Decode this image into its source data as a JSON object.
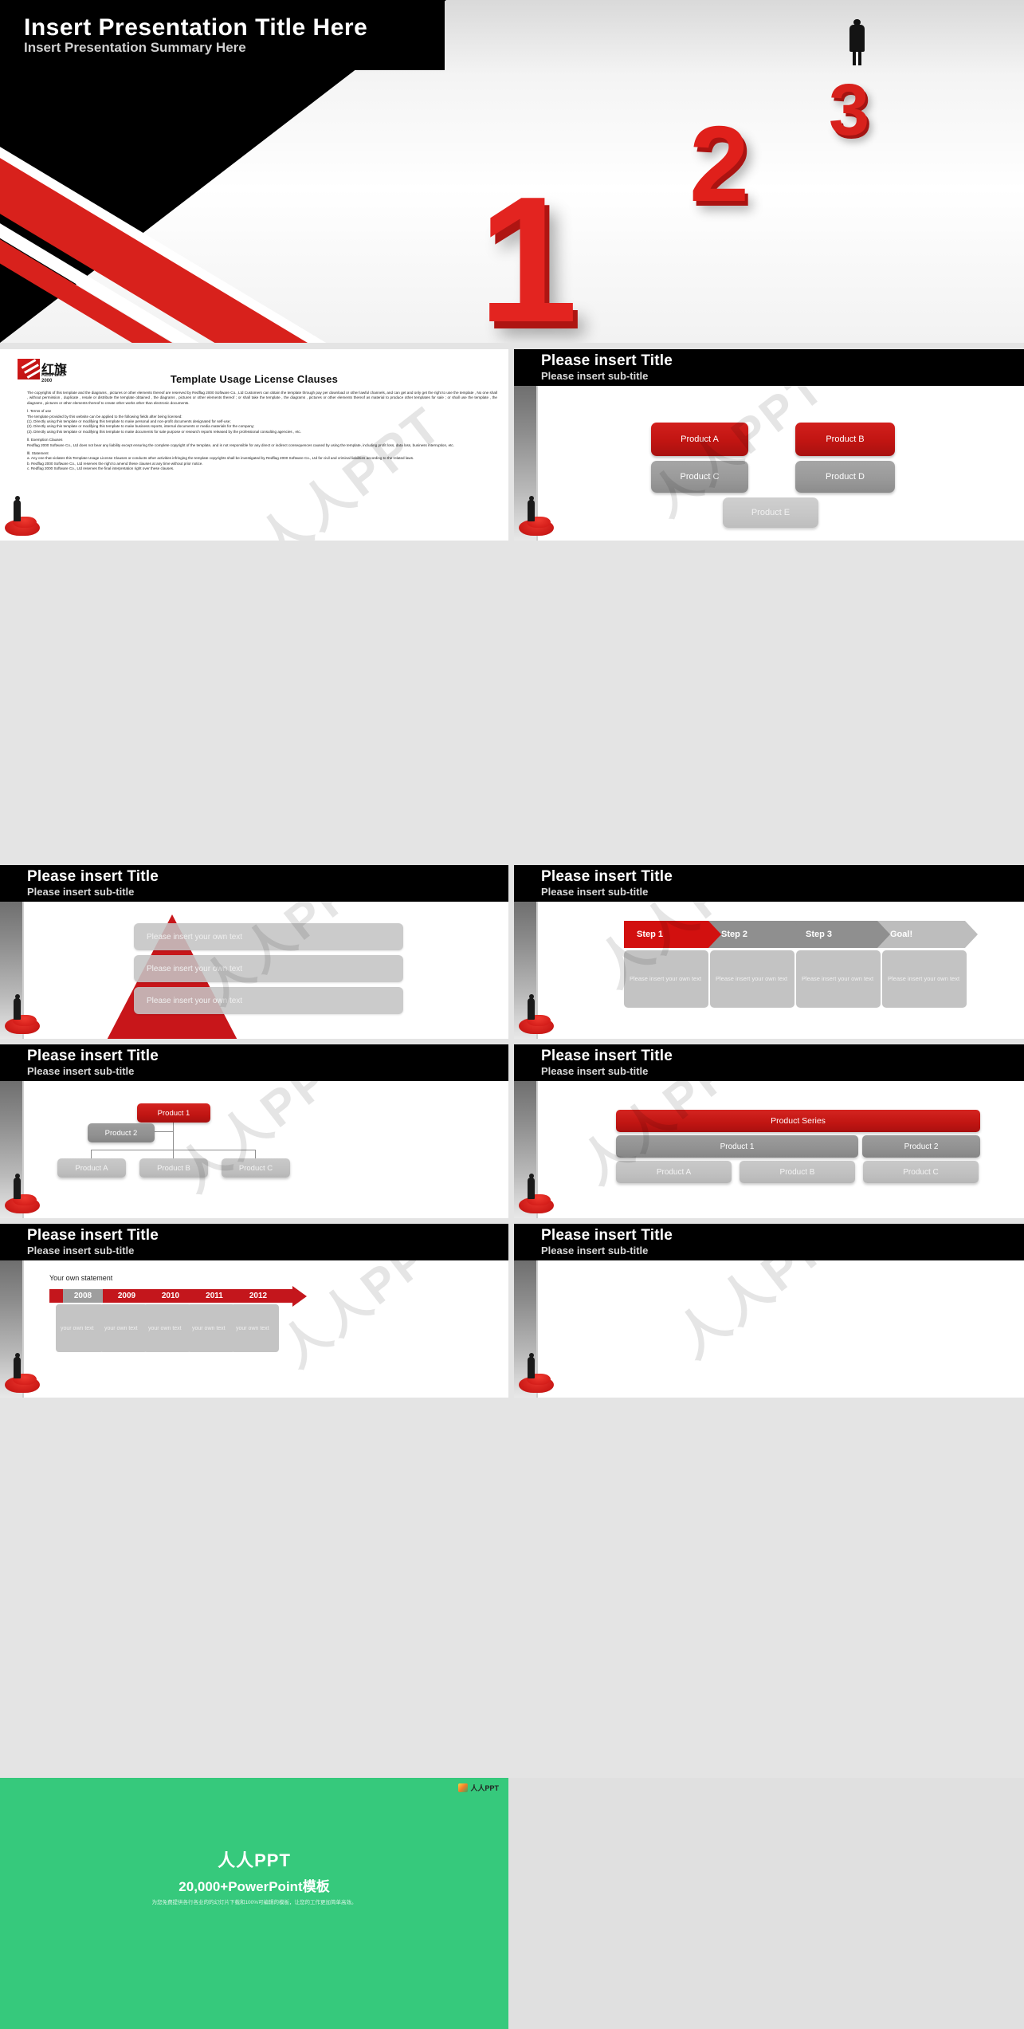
{
  "title_slide": {
    "title": "Insert Presentation Title Here",
    "subtitle": "Insert Presentation Summary Here",
    "numbers": [
      "1",
      "2",
      "3"
    ],
    "accent_color": "#e02020",
    "background_color": "#000000"
  },
  "license_slide": {
    "logo": {
      "cn": "红旗",
      "en_line1": "REDFLAG",
      "en_line2": "2000"
    },
    "heading": "Template Usage License Clauses",
    "paragraphs": [
      "The copyrights of this template and the diagrams , pictures or other elements thereof are reserved by Redflag 2000 Software Co., Ltd Customers can obtain the template through pay per download or other lawful channels, and can get and only get the right to use the template , No one shall , without  permission , duplicate , resale or distribute the template obtained , the diagrams , pictures or other elements thereof ; or shall take the template , the diagrams , pictures or other elements thereof as material to produce other templates for sale ; or shall use the template , the diagrams , pictures or other elements thereof to create other works other than electronic documents.",
      "Ⅰ. Terms of use",
      "The template provided by this website can be applied to the following fields after being licensed:",
      "(1). Directly using this template or modifying this template to make personal and non-profit documents designated for self-use;",
      "(2). Directly using this template or modifying this template to make business reports, internal documents or media materials for the company;",
      "(3). Directly using this template or modifying this template to make documents for sale purpose or research reports released by the professional consulting agencies , etc.",
      "Ⅱ. Exemption Clauses",
      "Redflag 2000 Software Co., Ltd does not bear any liability except ensuring the complete copyright of the template, and is not responsible for any direct or indirect consequences caused by using the template, including profit loss, data loss, business interruption, etc.",
      "Ⅲ. Statement",
      "a. Any one that violates this Template Usage License Clauses or conducts other activities infringing the template copyrights shall be investigated by Redflag 2000 Software Co., Ltd for civil and criminal liabilities according to the related laws.",
      "b. Redflag 2000 Software Co., Ltd reserves the right to amend these clauses at any time without prior notice.",
      "c. Redflag 2000 Software Co., Ltd reserves the final interpretation right over these clauses."
    ]
  },
  "common": {
    "title": "Please insert Title",
    "subtitle": "Please insert sub-title",
    "own_text": "Please insert your own text",
    "own_text_short": "Please insert your own text"
  },
  "slide_products": {
    "title": "Please insert Title",
    "subtitle": "Please insert sub-title",
    "buttons": [
      {
        "label": "Product A",
        "style": "red"
      },
      {
        "label": "Product B",
        "style": "red"
      },
      {
        "label": "Product C",
        "style": "gray"
      },
      {
        "label": "Product D",
        "style": "gray"
      },
      {
        "label": "Product E",
        "style": "light"
      }
    ]
  },
  "slide_pyramid": {
    "title": "Please insert Title",
    "subtitle": "Please insert sub-title",
    "rows": [
      "Please insert your own text",
      "Please insert your own text",
      "Please insert your own text"
    ]
  },
  "slide_steps": {
    "title": "Please insert Title",
    "subtitle": "Please insert sub-title",
    "steps": [
      {
        "label": "Step 1",
        "style": "red",
        "body": "Please insert your own text"
      },
      {
        "label": "Step 2",
        "style": "dark",
        "body": "Please insert your own text"
      },
      {
        "label": "Step 3",
        "style": "dark",
        "body": "Please insert your own text"
      },
      {
        "label": "Goal!",
        "style": "light",
        "body": "Please insert your own text"
      }
    ]
  },
  "slide_orgchart": {
    "title": "Please insert Title",
    "subtitle": "Please insert sub-title",
    "root": "Product 1",
    "branch": "Product 2",
    "leaves": [
      "Product A",
      "Product B",
      "Product C"
    ]
  },
  "slide_series": {
    "title": "Please insert Title",
    "subtitle": "Please insert sub-title",
    "header": "Product Series",
    "mid": [
      "Product 1",
      "Product 2"
    ],
    "bottom": [
      "Product A",
      "Product B",
      "Product C"
    ]
  },
  "slide_timeline": {
    "title": "Please insert Title",
    "subtitle": "Please insert sub-title",
    "statement": "Your own statement",
    "years": [
      "2008",
      "2009",
      "2010",
      "2011",
      "2012"
    ],
    "highlight_year": "2008",
    "cards": [
      "your own text",
      "your own text",
      "your own text",
      "your own text",
      "your own text"
    ]
  },
  "slide_cubes": {
    "title": "Please insert Title",
    "subtitle": "Please insert sub-title"
  },
  "promo": {
    "badge": "人人PPT",
    "brand": "人人PPT",
    "tagline": "20,000+PowerPoint模板",
    "description": "为您免费提供各行各业的的幻灯片下载和100%可编辑的模板，让您的工作更加简单高效。"
  },
  "watermark": "人人PPT"
}
